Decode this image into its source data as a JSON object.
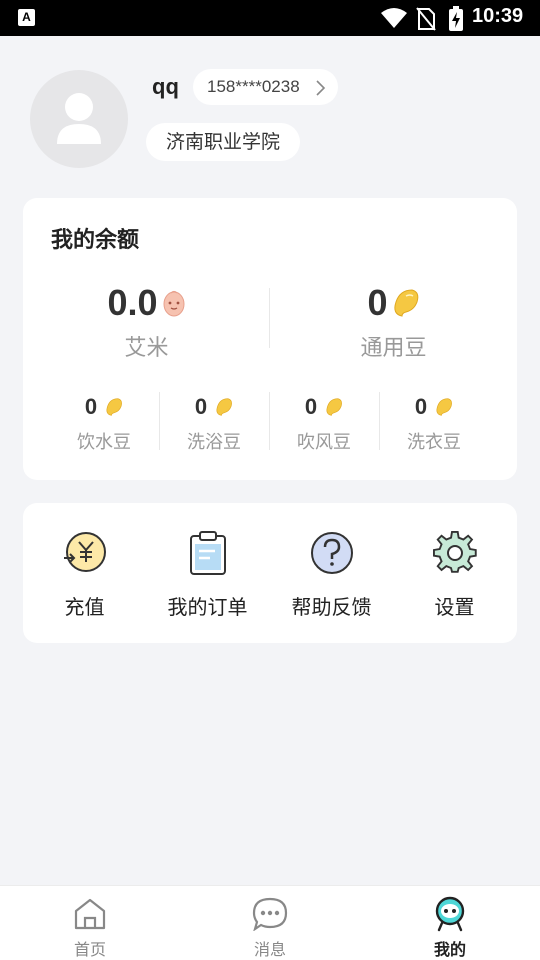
{
  "status_bar": {
    "time": "10:39"
  },
  "profile": {
    "username": "qq",
    "phone": "158****0238",
    "school": "济南职业学院"
  },
  "balance": {
    "title": "我的余额",
    "primary": [
      {
        "value": "0.0",
        "label": "艾米",
        "icon": "aimi-egg-icon"
      },
      {
        "value": "0",
        "label": "通用豆",
        "icon": "bean-icon"
      }
    ],
    "secondary": [
      {
        "value": "0",
        "label": "饮水豆",
        "icon": "bean-icon"
      },
      {
        "value": "0",
        "label": "洗浴豆",
        "icon": "bean-icon"
      },
      {
        "value": "0",
        "label": "吹风豆",
        "icon": "bean-icon"
      },
      {
        "value": "0",
        "label": "洗衣豆",
        "icon": "bean-icon"
      }
    ]
  },
  "menu": [
    {
      "label": "充值",
      "icon": "recharge-yen-icon"
    },
    {
      "label": "我的订单",
      "icon": "clipboard-icon"
    },
    {
      "label": "帮助反馈",
      "icon": "help-question-icon"
    },
    {
      "label": "设置",
      "icon": "gear-icon"
    }
  ],
  "bottom_nav": [
    {
      "label": "首页",
      "icon": "home-icon"
    },
    {
      "label": "消息",
      "icon": "message-icon"
    },
    {
      "label": "我的",
      "icon": "robot-avatar-icon"
    }
  ],
  "colors": {
    "background": "#f3f4f7",
    "accent_teal": "#4ed6d6",
    "bean_yellow": "#f5c842",
    "value_text": "#333333",
    "muted_text": "#999999"
  }
}
